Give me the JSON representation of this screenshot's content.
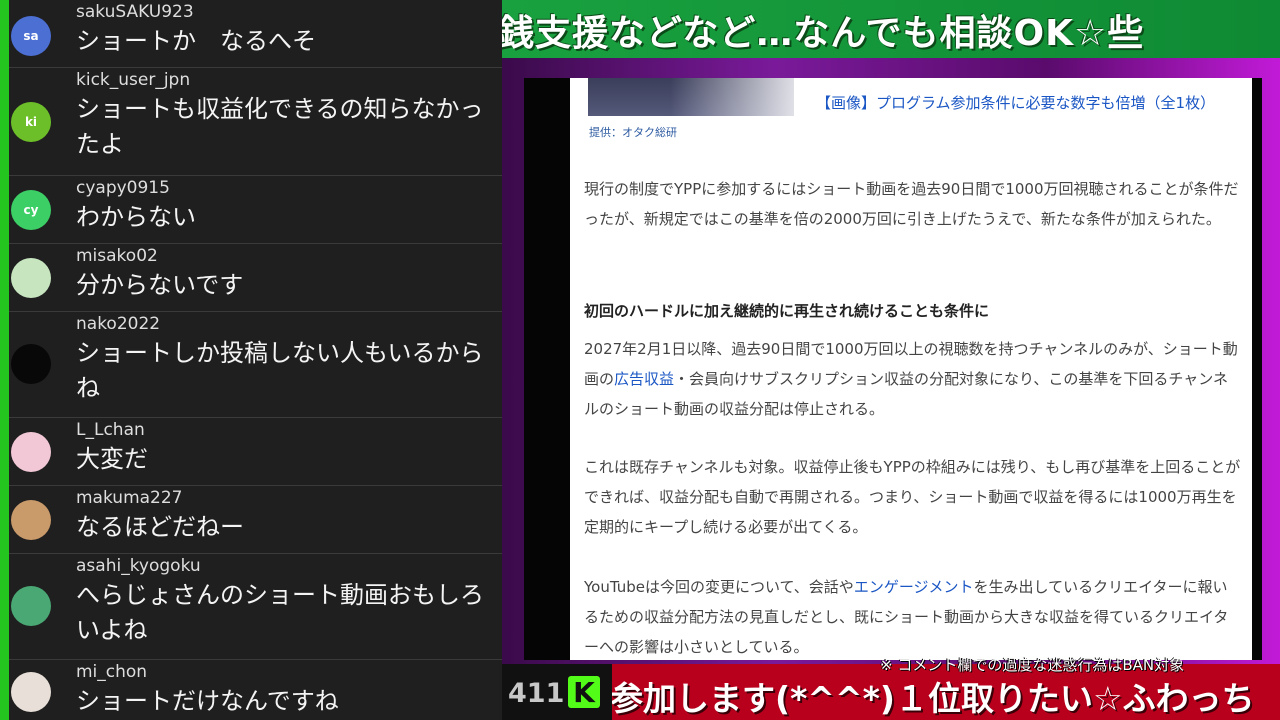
{
  "chat": {
    "messages": [
      {
        "user": "sakuSAKU923",
        "text": "ショートか　なるへそ",
        "avatar": "sa",
        "color": "#4c6fd3"
      },
      {
        "user": "kick_user_jpn",
        "text": "ショートも収益化できるの知らなかったよ",
        "avatar": "ki",
        "color": "#6dbf2a"
      },
      {
        "user": "cyapy0915",
        "text": "わからない",
        "avatar": "cy",
        "color": "#3ccf66"
      },
      {
        "user": "misako02",
        "text": "分からないです",
        "avatar": "",
        "color": "#c7e6c0"
      },
      {
        "user": "nako2022",
        "text": "ショートしか投稿しない人もいるからね",
        "avatar": "",
        "color": "#080808"
      },
      {
        "user": "L_Lchan",
        "text": "大変だ",
        "avatar": "",
        "color": "#f2c8d6"
      },
      {
        "user": "makuma227",
        "text": "なるほどだねー",
        "avatar": "",
        "color": "#c99a6a"
      },
      {
        "user": "asahi_kyogoku",
        "text": "へらじょさんのショート動画おもしろいよね",
        "avatar": "",
        "color": "#4aa874"
      },
      {
        "user": "mi_chon",
        "text": "ショートだけなんですね",
        "avatar": "",
        "color": "#e8e0d8"
      }
    ]
  },
  "stream": {
    "ticker_top": "銭支援などなど…なんでも相談OK☆些",
    "ticker_bottom": "参加します(*^^*)１位取りたい☆ふわっち",
    "notice": "※ コメント欄での過度な迷惑行為はBAN対象",
    "viewer_count": "411",
    "kick_logo": "K"
  },
  "article": {
    "image_credit": "提供：オタク総研",
    "image_link": "【画像】プログラム参加条件に必要な数字も倍増（全1枚）",
    "para1": "現行の制度でYPPに参加するにはショート動画を過去90日間で1000万回視聴されることが条件だったが、新規定ではこの基準を倍の2000万回に引き上げたうえで、新たな条件が加えられた。",
    "heading": "初回のハードルに加え継続的に再生され続けることも条件に",
    "para2_a": "2027年2月1日以降、過去90日間で1000万回以上の視聴数を持つチャンネルのみが、ショート動画の",
    "para2_link": "広告収益",
    "para2_b": "・会員向けサブスクリプション収益の分配対象になり、この基準を下回るチャンネルのショート動画の収益分配は停止される。",
    "para3": "これは既存チャンネルも対象。収益停止後もYPPの枠組みには残り、もし再び基準を上回ることができれば、収益分配も自動で再開される。つまり、ショート動画で収益を得るには1000万再生を定期的にキープし続ける必要が出てくる。",
    "para4_a": "YouTubeは今回の変更について、会話や",
    "para4_link": "エンゲージメント",
    "para4_b": "を生み出しているクリエイターに報いるための収益分配方法の見直しだとし、既にショート動画から大きな収益を得ているクリエイターへの影響は小さいとしている。"
  }
}
